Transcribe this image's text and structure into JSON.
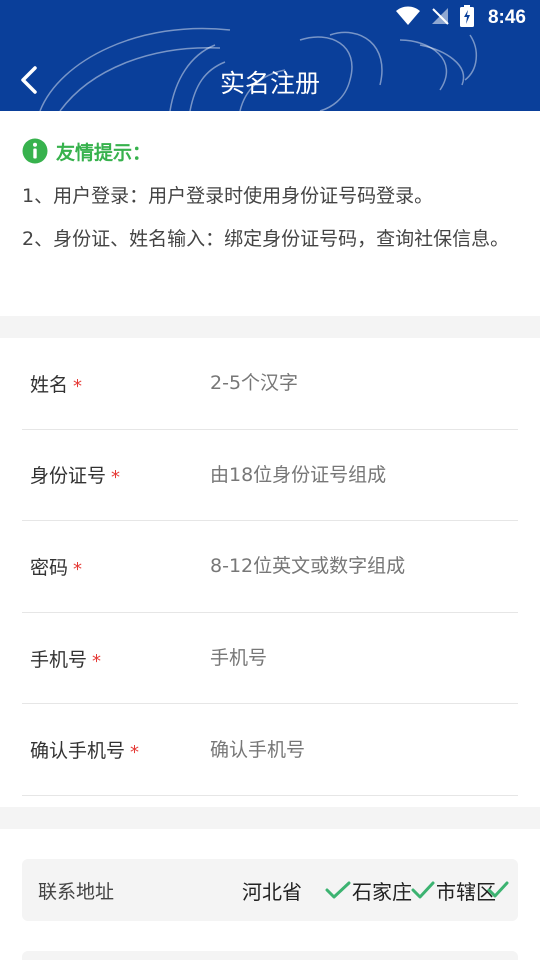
{
  "status": {
    "time": "8:46"
  },
  "header": {
    "title": "实名注册"
  },
  "icons": {
    "back": "chevron-left-icon",
    "info": "info-icon",
    "check": "check-icon",
    "wifi": "wifi-icon",
    "signal": "signal-off-icon",
    "battery": "battery-charging-icon"
  },
  "colors": {
    "primary": "#0a3f9a",
    "tip_green": "#37b24d",
    "required": "#e53935",
    "check_green": "#3cb371"
  },
  "tips": {
    "title": "友情提示：",
    "lines": [
      "1、用户登录：用户登录时使用身份证号码登录。",
      "2、身份证、姓名输入：绑定身份证号码，查询社保信息。"
    ]
  },
  "form": {
    "required_mark": "*",
    "fields": [
      {
        "label": "姓名",
        "placeholder": "2-5个汉字",
        "value": ""
      },
      {
        "label": "身份证号",
        "placeholder": "由18位身份证号组成",
        "value": ""
      },
      {
        "label": "密码",
        "placeholder": "8-12位英文或数字组成",
        "value": ""
      },
      {
        "label": "手机号",
        "placeholder": "手机号",
        "value": ""
      },
      {
        "label": "确认手机号",
        "placeholder": "确认手机号",
        "value": ""
      }
    ]
  },
  "address": {
    "label": "联系地址",
    "province": "河北省",
    "city": "石家庄",
    "district": "市辖区"
  }
}
